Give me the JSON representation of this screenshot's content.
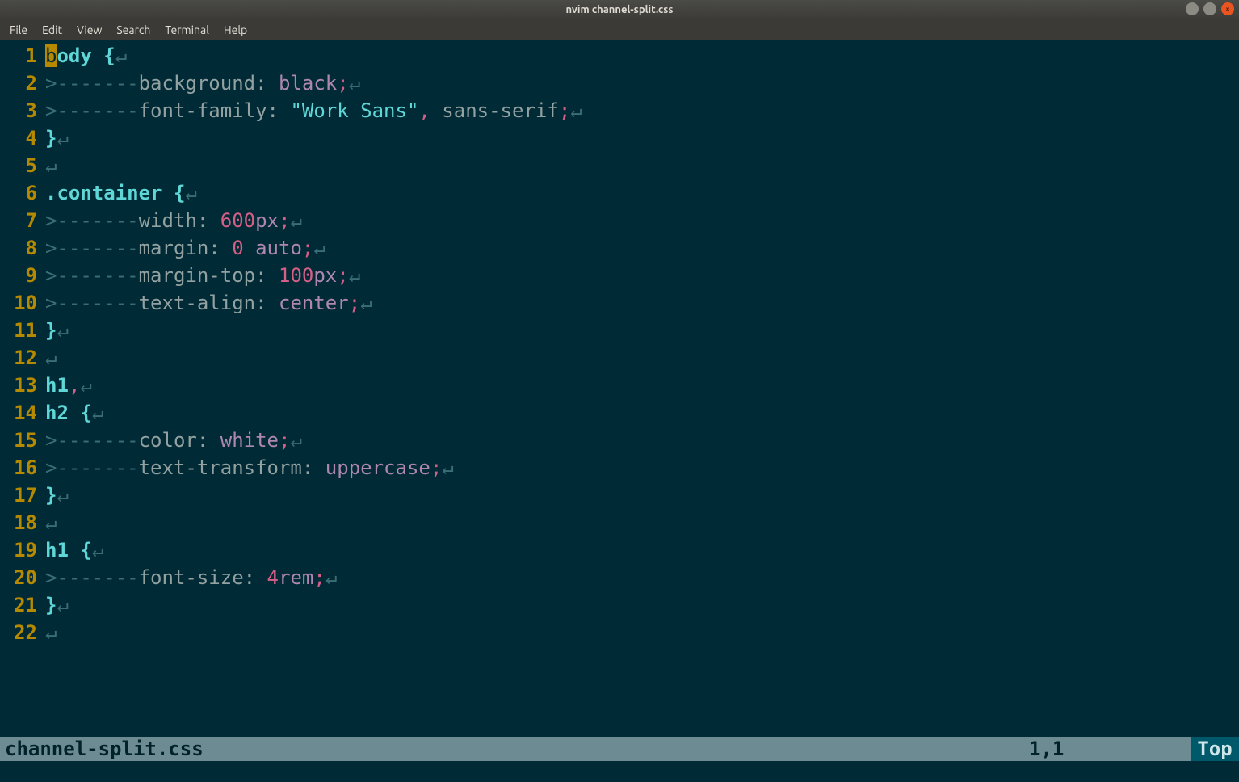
{
  "title": "nvim channel-split.css",
  "menu": [
    "File",
    "Edit",
    "View",
    "Search",
    "Terminal",
    "Help"
  ],
  "status": {
    "file": "channel-split.css",
    "pos": "1,1",
    "scroll": "Top"
  },
  "glyph": {
    "tab": ">-------",
    "eol": "↵"
  },
  "lines": [
    {
      "n": "1",
      "t": [
        {
          "c": "cursor",
          "v": "b"
        },
        {
          "c": "sel",
          "v": "ody "
        },
        {
          "c": "brace",
          "v": "{"
        },
        {
          "c": "eol",
          "v": "↵"
        }
      ]
    },
    {
      "n": "2",
      "t": [
        {
          "c": "tab",
          "v": ">-------"
        },
        {
          "c": "prop",
          "v": "background"
        },
        {
          "c": "colon",
          "v": ": "
        },
        {
          "c": "kw",
          "v": "black"
        },
        {
          "c": "semi",
          "v": ";"
        },
        {
          "c": "eol",
          "v": "↵"
        }
      ]
    },
    {
      "n": "3",
      "t": [
        {
          "c": "tab",
          "v": ">-------"
        },
        {
          "c": "prop",
          "v": "font-family"
        },
        {
          "c": "colon",
          "v": ": "
        },
        {
          "c": "str",
          "v": "\"Work Sans\""
        },
        {
          "c": "comma",
          "v": ","
        },
        {
          "c": "prop",
          "v": " sans-serif"
        },
        {
          "c": "semi",
          "v": ";"
        },
        {
          "c": "eol",
          "v": "↵"
        }
      ]
    },
    {
      "n": "4",
      "t": [
        {
          "c": "brace",
          "v": "}"
        },
        {
          "c": "eol",
          "v": "↵"
        }
      ]
    },
    {
      "n": "5",
      "t": [
        {
          "c": "eol",
          "v": "↵"
        }
      ]
    },
    {
      "n": "6",
      "t": [
        {
          "c": "sel",
          "v": ".container "
        },
        {
          "c": "brace",
          "v": "{"
        },
        {
          "c": "eol",
          "v": "↵"
        }
      ]
    },
    {
      "n": "7",
      "t": [
        {
          "c": "tab",
          "v": ">-------"
        },
        {
          "c": "prop",
          "v": "width"
        },
        {
          "c": "colon",
          "v": ": "
        },
        {
          "c": "num",
          "v": "600"
        },
        {
          "c": "kw",
          "v": "px"
        },
        {
          "c": "semi",
          "v": ";"
        },
        {
          "c": "eol",
          "v": "↵"
        }
      ]
    },
    {
      "n": "8",
      "t": [
        {
          "c": "tab",
          "v": ">-------"
        },
        {
          "c": "prop",
          "v": "margin"
        },
        {
          "c": "colon",
          "v": ": "
        },
        {
          "c": "num",
          "v": "0"
        },
        {
          "c": "prop",
          "v": " "
        },
        {
          "c": "kw",
          "v": "auto"
        },
        {
          "c": "semi",
          "v": ";"
        },
        {
          "c": "eol",
          "v": "↵"
        }
      ]
    },
    {
      "n": "9",
      "t": [
        {
          "c": "tab",
          "v": ">-------"
        },
        {
          "c": "prop",
          "v": "margin-top"
        },
        {
          "c": "colon",
          "v": ": "
        },
        {
          "c": "num",
          "v": "100"
        },
        {
          "c": "kw",
          "v": "px"
        },
        {
          "c": "semi",
          "v": ";"
        },
        {
          "c": "eol",
          "v": "↵"
        }
      ]
    },
    {
      "n": "10",
      "t": [
        {
          "c": "tab",
          "v": ">-------"
        },
        {
          "c": "prop",
          "v": "text-align"
        },
        {
          "c": "colon",
          "v": ": "
        },
        {
          "c": "kw",
          "v": "center"
        },
        {
          "c": "semi",
          "v": ";"
        },
        {
          "c": "eol",
          "v": "↵"
        }
      ]
    },
    {
      "n": "11",
      "t": [
        {
          "c": "brace",
          "v": "}"
        },
        {
          "c": "eol",
          "v": "↵"
        }
      ]
    },
    {
      "n": "12",
      "t": [
        {
          "c": "eol",
          "v": "↵"
        }
      ]
    },
    {
      "n": "13",
      "t": [
        {
          "c": "sel",
          "v": "h1"
        },
        {
          "c": "comma",
          "v": ","
        },
        {
          "c": "eol",
          "v": "↵"
        }
      ]
    },
    {
      "n": "14",
      "t": [
        {
          "c": "sel",
          "v": "h2 "
        },
        {
          "c": "brace",
          "v": "{"
        },
        {
          "c": "eol",
          "v": "↵"
        }
      ]
    },
    {
      "n": "15",
      "t": [
        {
          "c": "tab",
          "v": ">-------"
        },
        {
          "c": "prop",
          "v": "color"
        },
        {
          "c": "colon",
          "v": ": "
        },
        {
          "c": "kw",
          "v": "white"
        },
        {
          "c": "semi",
          "v": ";"
        },
        {
          "c": "eol",
          "v": "↵"
        }
      ]
    },
    {
      "n": "16",
      "t": [
        {
          "c": "tab",
          "v": ">-------"
        },
        {
          "c": "prop",
          "v": "text-transform"
        },
        {
          "c": "colon",
          "v": ": "
        },
        {
          "c": "kw",
          "v": "uppercase"
        },
        {
          "c": "semi",
          "v": ";"
        },
        {
          "c": "eol",
          "v": "↵"
        }
      ]
    },
    {
      "n": "17",
      "t": [
        {
          "c": "brace",
          "v": "}"
        },
        {
          "c": "eol",
          "v": "↵"
        }
      ]
    },
    {
      "n": "18",
      "t": [
        {
          "c": "eol",
          "v": "↵"
        }
      ]
    },
    {
      "n": "19",
      "t": [
        {
          "c": "sel",
          "v": "h1 "
        },
        {
          "c": "brace",
          "v": "{"
        },
        {
          "c": "eol",
          "v": "↵"
        }
      ]
    },
    {
      "n": "20",
      "t": [
        {
          "c": "tab",
          "v": ">-------"
        },
        {
          "c": "prop",
          "v": "font-size"
        },
        {
          "c": "colon",
          "v": ": "
        },
        {
          "c": "num",
          "v": "4"
        },
        {
          "c": "kw",
          "v": "rem"
        },
        {
          "c": "semi",
          "v": ";"
        },
        {
          "c": "eol",
          "v": "↵"
        }
      ]
    },
    {
      "n": "21",
      "t": [
        {
          "c": "brace",
          "v": "}"
        },
        {
          "c": "eol",
          "v": "↵"
        }
      ]
    },
    {
      "n": "22",
      "t": [
        {
          "c": "eol",
          "v": "↵"
        }
      ]
    }
  ]
}
